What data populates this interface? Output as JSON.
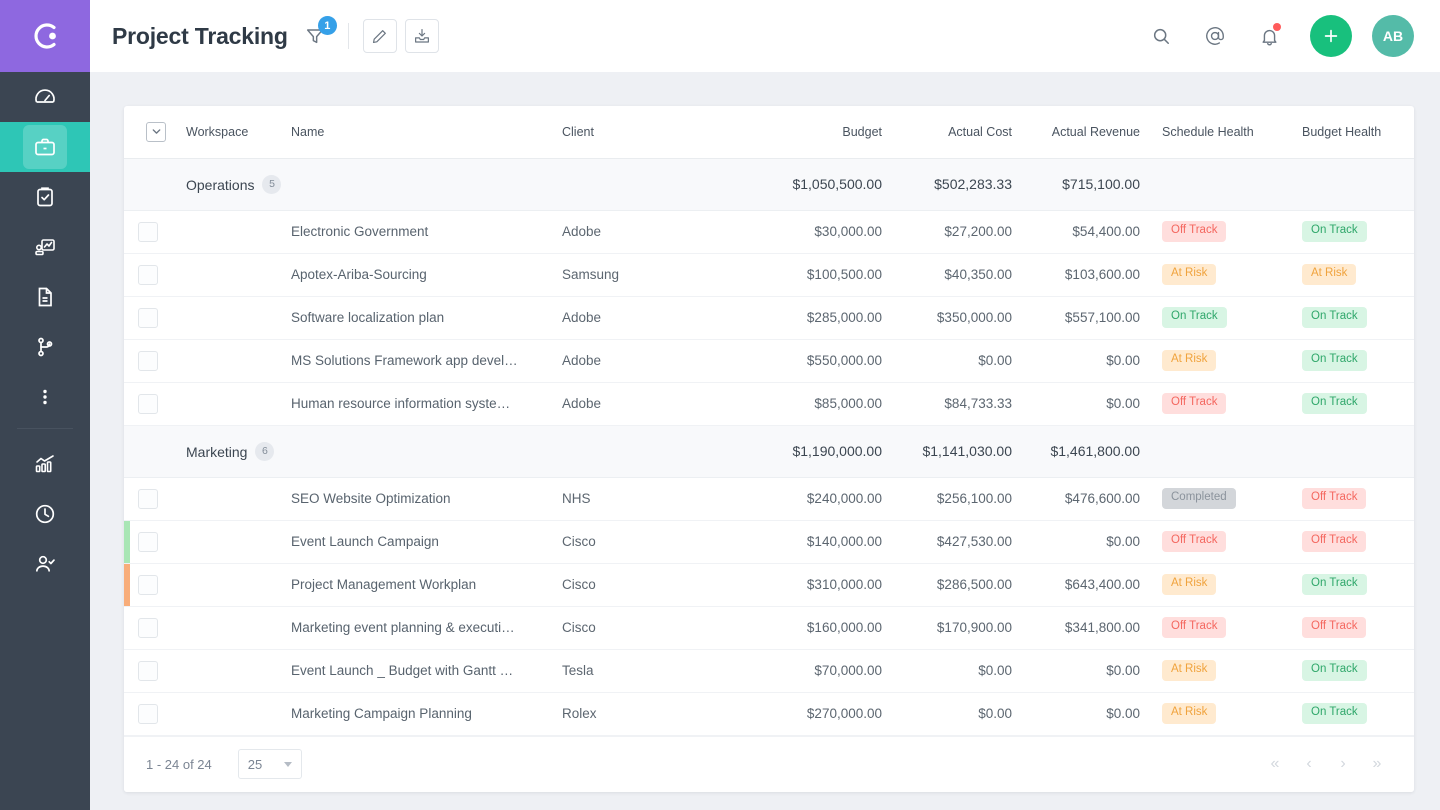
{
  "brand": {
    "logo_icon": "circle-logo-icon",
    "logo_bg": "#8e68e0",
    "sidebar_bg": "#3b4552",
    "active_bg": "#2ec6b6"
  },
  "sidebar": {
    "items": [
      {
        "icon": "dashboard-gauge-icon",
        "name": "sidebar-item-dashboard",
        "active": false
      },
      {
        "icon": "briefcase-icon",
        "name": "sidebar-item-projects",
        "active": true
      },
      {
        "icon": "clipboard-check-icon",
        "name": "sidebar-item-tasks",
        "active": false
      },
      {
        "icon": "presentation-chart-icon",
        "name": "sidebar-item-reports",
        "active": false
      },
      {
        "icon": "document-icon",
        "name": "sidebar-item-documents",
        "active": false
      },
      {
        "icon": "workflow-branch-icon",
        "name": "sidebar-item-workflow",
        "active": false
      },
      {
        "icon": "more-vertical-icon",
        "name": "sidebar-item-more",
        "active": false
      }
    ],
    "items_bottom": [
      {
        "icon": "analytics-bars-icon",
        "name": "sidebar-item-analytics"
      },
      {
        "icon": "clock-icon",
        "name": "sidebar-item-timesheets"
      },
      {
        "icon": "user-check-icon",
        "name": "sidebar-item-resources"
      }
    ]
  },
  "header": {
    "title": "Project Tracking",
    "filter_icon": "filter-funnel-icon",
    "filter_badge": "1",
    "filter_badge_color": "#35a0e8",
    "edit_icon": "pencil-edit-icon",
    "export_icon": "export-download-icon",
    "search_icon": "search-icon",
    "mention_icon": "at-mention-icon",
    "notification_icon": "bell-icon",
    "notification_dot": true,
    "add_icon": "plus-icon",
    "add_color": "#18c07d",
    "avatar_initials": "AB",
    "avatar_color": "#54bba8"
  },
  "table": {
    "columns": [
      {
        "key": "checkbox",
        "label": "",
        "align": "left"
      },
      {
        "key": "workspace",
        "label": "Workspace",
        "align": "left"
      },
      {
        "key": "name",
        "label": "Name",
        "align": "left"
      },
      {
        "key": "client",
        "label": "Client",
        "align": "left"
      },
      {
        "key": "budget",
        "label": "Budget",
        "align": "right"
      },
      {
        "key": "actual_cost",
        "label": "Actual Cost",
        "align": "right"
      },
      {
        "key": "actual_revenue",
        "label": "Actual Revenue",
        "align": "right"
      },
      {
        "key": "schedule_health",
        "label": "Schedule Health",
        "align": "left"
      },
      {
        "key": "budget_health",
        "label": "Budget Health",
        "align": "left"
      }
    ],
    "groups": [
      {
        "name": "Operations",
        "count": "5",
        "budget": "$1,050,500.00",
        "actual_cost": "$502,283.33",
        "actual_revenue": "$715,100.00",
        "rows": [
          {
            "name": "Electronic Government",
            "client": "Adobe",
            "budget": "$30,000.00",
            "actual_cost": "$27,200.00",
            "actual_revenue": "$54,400.00",
            "schedule_health": "Off Track",
            "schedule_type": "offtrack",
            "budget_health": "On Track",
            "budget_type": "ontrack",
            "flag": ""
          },
          {
            "name": "Apotex-Ariba-Sourcing",
            "client": "Samsung",
            "budget": "$100,500.00",
            "actual_cost": "$40,350.00",
            "actual_revenue": "$103,600.00",
            "schedule_health": "At Risk",
            "schedule_type": "atrisk",
            "budget_health": "At Risk",
            "budget_type": "atrisk",
            "flag": ""
          },
          {
            "name": "Software localization plan",
            "client": "Adobe",
            "budget": "$285,000.00",
            "actual_cost": "$350,000.00",
            "actual_revenue": "$557,100.00",
            "schedule_health": "On Track",
            "schedule_type": "ontrack",
            "budget_health": "On Track",
            "budget_type": "ontrack",
            "flag": ""
          },
          {
            "name": "MS Solutions Framework app devel…",
            "client": "Adobe",
            "budget": "$550,000.00",
            "actual_cost": "$0.00",
            "actual_revenue": "$0.00",
            "schedule_health": "At Risk",
            "schedule_type": "atrisk",
            "budget_health": "On Track",
            "budget_type": "ontrack",
            "flag": ""
          },
          {
            "name": "Human resource information syste…",
            "client": "Adobe",
            "budget": "$85,000.00",
            "actual_cost": "$84,733.33",
            "actual_revenue": "$0.00",
            "schedule_health": "Off Track",
            "schedule_type": "offtrack",
            "budget_health": "On Track",
            "budget_type": "ontrack",
            "flag": ""
          }
        ]
      },
      {
        "name": "Marketing",
        "count": "6",
        "budget": "$1,190,000.00",
        "actual_cost": "$1,141,030.00",
        "actual_revenue": "$1,461,800.00",
        "rows": [
          {
            "name": "SEO Website Optimization",
            "client": "NHS",
            "budget": "$240,000.00",
            "actual_cost": "$256,100.00",
            "actual_revenue": "$476,600.00",
            "schedule_health": "Completed",
            "schedule_type": "completed",
            "budget_health": "Off Track",
            "budget_type": "offtrack",
            "flag": ""
          },
          {
            "name": "Event Launch Campaign",
            "client": "Cisco",
            "budget": "$140,000.00",
            "actual_cost": "$427,530.00",
            "actual_revenue": "$0.00",
            "schedule_health": "Off Track",
            "schedule_type": "offtrack",
            "budget_health": "Off Track",
            "budget_type": "offtrack",
            "flag": "#a9e6b5"
          },
          {
            "name": "Project Management Workplan",
            "client": "Cisco",
            "budget": "$310,000.00",
            "actual_cost": "$286,500.00",
            "actual_revenue": "$643,400.00",
            "schedule_health": "At Risk",
            "schedule_type": "atrisk",
            "budget_health": "On Track",
            "budget_type": "ontrack",
            "flag": "#f8ad7a"
          },
          {
            "name": "Marketing event planning & executi…",
            "client": "Cisco",
            "budget": "$160,000.00",
            "actual_cost": "$170,900.00",
            "actual_revenue": "$341,800.00",
            "schedule_health": "Off Track",
            "schedule_type": "offtrack",
            "budget_health": "Off Track",
            "budget_type": "offtrack",
            "flag": ""
          },
          {
            "name": "Event Launch _ Budget with Gantt …",
            "client": "Tesla",
            "budget": "$70,000.00",
            "actual_cost": "$0.00",
            "actual_revenue": "$0.00",
            "schedule_health": "At Risk",
            "schedule_type": "atrisk",
            "budget_health": "On Track",
            "budget_type": "ontrack",
            "flag": ""
          },
          {
            "name": "Marketing Campaign Planning",
            "client": "Rolex",
            "budget": "$270,000.00",
            "actual_cost": "$0.00",
            "actual_revenue": "$0.00",
            "schedule_health": "At Risk",
            "schedule_type": "atrisk",
            "budget_health": "On Track",
            "budget_type": "ontrack",
            "flag": ""
          }
        ]
      }
    ]
  },
  "footer": {
    "range": "1 - 24 of 24",
    "page_size": "25",
    "first_icon": "chevron-double-left-icon",
    "prev_icon": "chevron-left-icon",
    "next_icon": "chevron-right-icon",
    "last_icon": "chevron-double-right-icon",
    "first_label": "«",
    "prev_label": "‹",
    "next_label": "›",
    "last_label": "»"
  },
  "status_colors": {
    "on_track_bg": "#d8f5e4",
    "on_track_fg": "#2fa76a",
    "off_track_bg": "#ffdedd",
    "off_track_fg": "#f4675f",
    "at_risk_bg": "#ffeacf",
    "at_risk_fg": "#f0a33d",
    "completed_bg": "#d3d6da",
    "completed_fg": "#8b939c"
  }
}
